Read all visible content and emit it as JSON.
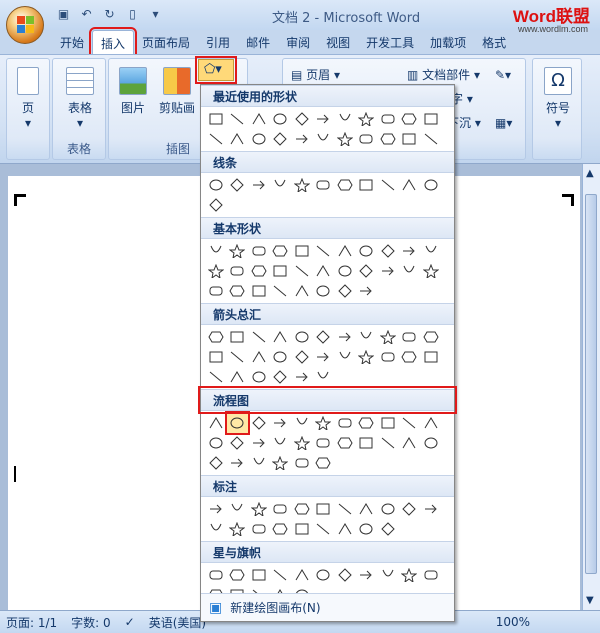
{
  "window": {
    "title": "文档 2 - Microsoft Word",
    "brand_main": "Word联盟",
    "brand_url": "www.wordlm.com"
  },
  "tabs": [
    "开始",
    "插入",
    "页面布局",
    "引用",
    "邮件",
    "审阅",
    "视图",
    "开发工具",
    "加载项",
    "格式"
  ],
  "ribbon": {
    "page_label": "页",
    "table_label": "表格",
    "table_group": "表格",
    "picture_label": "图片",
    "clipart_label": "剪贴画",
    "illustration_group": "插图",
    "header_label": "页眉",
    "docparts_label": "文档部件",
    "char_label": "字",
    "dropcap_label": "下沉",
    "symbol_label": "符号"
  },
  "shapes_menu": {
    "sections": [
      {
        "title": "最近使用的形状",
        "count": 22
      },
      {
        "title": "线条",
        "count": 12
      },
      {
        "title": "基本形状",
        "count": 30
      },
      {
        "title": "箭头总汇",
        "count": 28
      },
      {
        "title": "流程图",
        "count": 28
      },
      {
        "title": "标注",
        "count": 20
      },
      {
        "title": "星与旗帜",
        "count": 16
      }
    ],
    "footer": "新建绘图画布(N)"
  },
  "status": {
    "page": "页面: 1/1",
    "words": "字数: 0",
    "lang": "英语(美国)",
    "zoom": "100%"
  },
  "colors": {
    "highlight": "#e01a1a",
    "accent": "#15396b"
  }
}
